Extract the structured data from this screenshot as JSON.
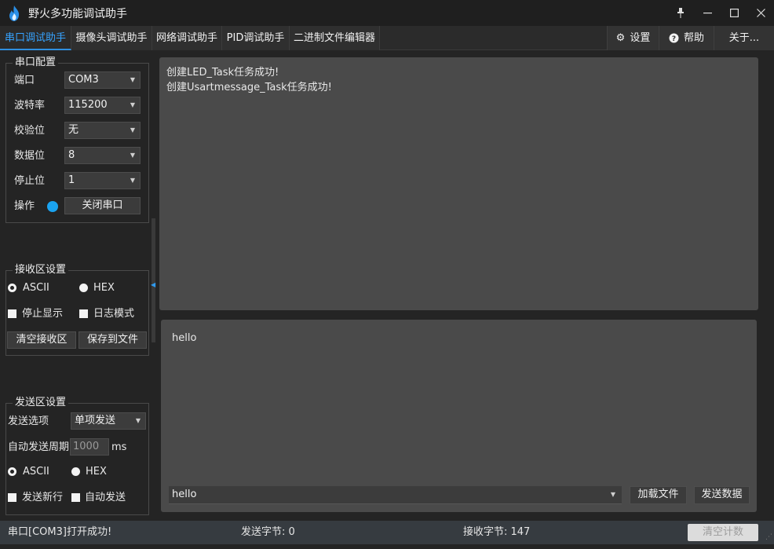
{
  "window": {
    "title": "野火多功能调试助手",
    "controls": {
      "pin": "📌",
      "minimize": "—",
      "maximize": "☐",
      "close": "✕"
    }
  },
  "tabs": [
    {
      "label": "串口调试助手",
      "active": true
    },
    {
      "label": "摄像头调试助手",
      "active": false
    },
    {
      "label": "网络调试助手",
      "active": false
    },
    {
      "label": "PID调试助手",
      "active": false
    },
    {
      "label": "二进制文件编辑器",
      "active": false
    }
  ],
  "toolbar": {
    "settings_icon": "gear-icon",
    "settings_label": "设置",
    "help_icon": "help-icon",
    "help_label": "帮助",
    "about_label": "关于..."
  },
  "serial_config": {
    "title": "串口配置",
    "port_label": "端口",
    "port_value": "COM3",
    "baud_label": "波特率",
    "baud_value": "115200",
    "parity_label": "校验位",
    "parity_value": "无",
    "databits_label": "数据位",
    "databits_value": "8",
    "stopbits_label": "停止位",
    "stopbits_value": "1",
    "operation_label": "操作",
    "close_port_label": "关闭串口",
    "led_color": "#1aa3f0"
  },
  "receive_settings": {
    "title": "接收区设置",
    "ascii_label": "ASCII",
    "hex_label": "HEX",
    "mode": "ASCII",
    "stop_display_label": "停止显示",
    "log_mode_label": "日志模式",
    "clear_label": "清空接收区",
    "save_label": "保存到文件"
  },
  "send_settings": {
    "title": "发送区设置",
    "option_label": "发送选项",
    "option_value": "单项发送",
    "period_label": "自动发送周期",
    "period_value": "1000",
    "period_unit": "ms",
    "ascii_label": "ASCII",
    "hex_label": "HEX",
    "mode": "ASCII",
    "newline_label": "发送新行",
    "auto_send_label": "自动发送"
  },
  "receive_area": {
    "lines": [
      "创建LED_Task任务成功!",
      "创建Usartmessage_Task任务成功!"
    ]
  },
  "send_area": {
    "text": "hello",
    "combo_value": "hello",
    "load_file_label": "加载文件",
    "send_label": "发送数据"
  },
  "status": {
    "message": "串口[COM3]打开成功!",
    "sent_bytes": "发送字节: 0",
    "recv_bytes": "接收字节: 147",
    "clear_count_label": "清空计数"
  },
  "colors": {
    "accent": "#2f8fe0",
    "background": "#242424",
    "panel": "#4a4a4a"
  }
}
